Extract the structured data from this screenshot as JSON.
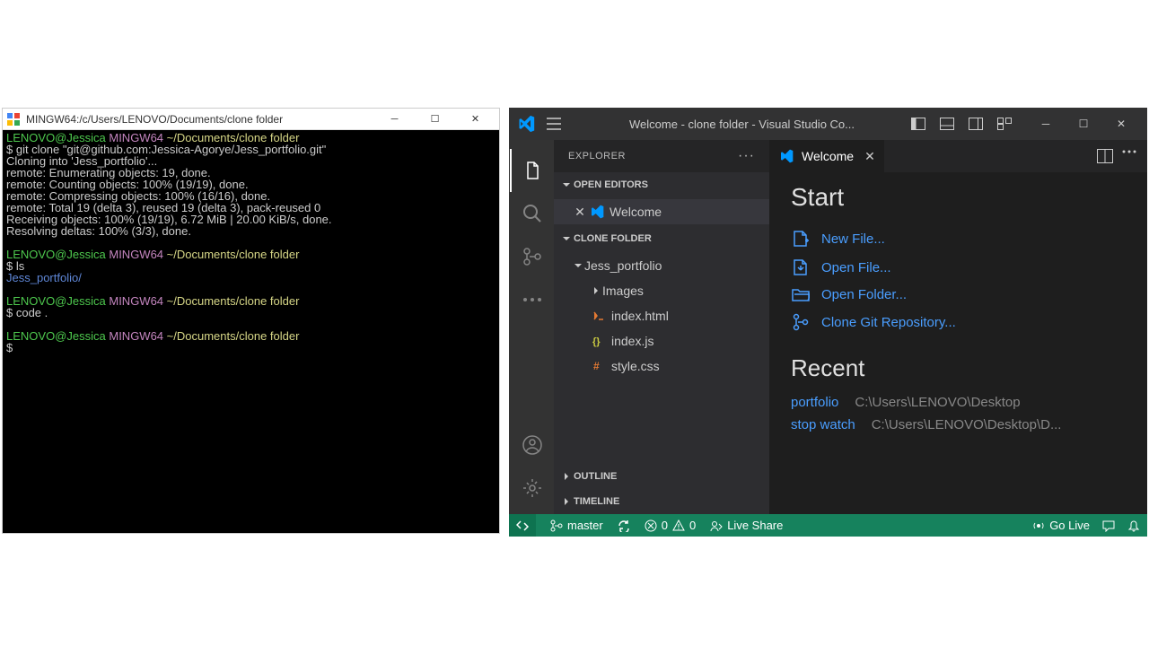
{
  "terminal": {
    "title": "MINGW64:/c/Users/LENOVO/Documents/clone folder",
    "prompt_user": "LENOVO@Jessica",
    "prompt_env": "MINGW64",
    "prompt_path": "~/Documents/clone folder",
    "cmd1": "git clone \"git@github.com:Jessica-Agorye/Jess_portfolio.git\"",
    "out1": "Cloning into 'Jess_portfolio'...",
    "out2": "remote: Enumerating objects: 19, done.",
    "out3": "remote: Counting objects: 100% (19/19), done.",
    "out4": "remote: Compressing objects: 100% (16/16), done.",
    "out5": "remote: Total 19 (delta 3), reused 19 (delta 3), pack-reused 0",
    "out6": "Receiving objects: 100% (19/19), 6.72 MiB | 20.00 KiB/s, done.",
    "out7": "Resolving deltas: 100% (3/3), done.",
    "cmd2": "ls",
    "ls_output": "Jess_portfolio/",
    "cmd3": "code .",
    "dollar": "$"
  },
  "vscode": {
    "title": "Welcome - clone folder - Visual Studio Co...",
    "tab_name": "Welcome",
    "sidebar": {
      "title": "EXPLORER",
      "open_editors": "OPEN EDITORS",
      "editor_item": "Welcome",
      "folder_name": "CLONE FOLDER",
      "root_folder": "Jess_portfolio",
      "files": {
        "images": "Images",
        "index_html": "index.html",
        "index_js": "index.js",
        "style_css": "style.css"
      },
      "outline": "OUTLINE",
      "timeline": "TIMELINE"
    },
    "welcome": {
      "start_heading": "Start",
      "new_file": "New File...",
      "open_file": "Open File...",
      "open_folder": "Open Folder...",
      "clone_repo": "Clone Git Repository...",
      "recent_heading": "Recent",
      "recent": [
        {
          "name": "portfolio",
          "path": "C:\\Users\\LENOVO\\Desktop"
        },
        {
          "name": "stop watch",
          "path": "C:\\Users\\LENOVO\\Desktop\\D..."
        }
      ]
    },
    "status": {
      "branch": "master",
      "errors": "0",
      "warnings": "0",
      "live_share": "Live Share",
      "go_live": "Go Live"
    }
  }
}
